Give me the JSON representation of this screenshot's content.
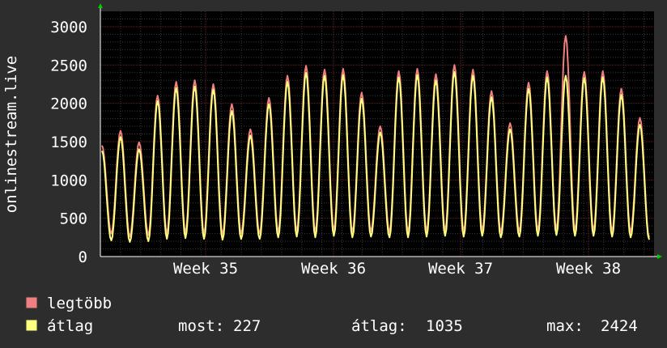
{
  "chart_data": {
    "type": "line",
    "ylabel": "onlinestream.live",
    "ylim": [
      0,
      3200
    ],
    "yticks": [
      0,
      500,
      1000,
      1500,
      2000,
      2500,
      3000
    ],
    "xticks": [
      "Week 35",
      "Week 36",
      "Week 37",
      "Week 38"
    ],
    "grid": true,
    "colors": {
      "background": "#2d2d2d",
      "plot": "#000000",
      "grid_major": "#6a2020",
      "grid_minor": "#3a3a3a",
      "text": "#ffffff",
      "max_series": "#f08080",
      "avg_series": "#ffff80",
      "axis_arrow": "#00cc00"
    },
    "series": [
      {
        "name": "legtöbb",
        "values": [
          1450,
          300,
          1640,
          260,
          1490,
          280,
          2100,
          300,
          2280,
          310,
          2300,
          300,
          2250,
          290,
          1990,
          300,
          1660,
          300,
          2070,
          320,
          2360,
          330,
          2490,
          320,
          2440,
          340,
          2450,
          320,
          2140,
          330,
          1700,
          320,
          2420,
          320,
          2450,
          330,
          2380,
          340,
          2500,
          330,
          2440,
          340,
          2160,
          320,
          1740,
          330,
          2270,
          340,
          2420,
          350,
          2880,
          340,
          2410,
          340,
          2420,
          330,
          2190,
          320,
          1810,
          250
        ]
      },
      {
        "name": "átlag",
        "values": [
          1380,
          210,
          1560,
          190,
          1400,
          200,
          2030,
          230,
          2200,
          240,
          2220,
          230,
          2180,
          220,
          1900,
          230,
          1580,
          230,
          1990,
          250,
          2280,
          260,
          2400,
          250,
          2360,
          270,
          2370,
          250,
          2060,
          260,
          1620,
          250,
          2340,
          250,
          2370,
          260,
          2300,
          270,
          2410,
          260,
          2360,
          270,
          2080,
          250,
          1660,
          260,
          2190,
          270,
          2340,
          280,
          2360,
          270,
          2330,
          270,
          2340,
          260,
          2110,
          250,
          1720,
          220
        ]
      }
    ]
  },
  "legend": {
    "max_label": "legtöbb",
    "avg_label": "átlag",
    "stats": [
      {
        "label": "most:",
        "value": "227"
      },
      {
        "label": "átlag:",
        "value": "1035"
      },
      {
        "label": "max:",
        "value": "2424"
      }
    ]
  }
}
